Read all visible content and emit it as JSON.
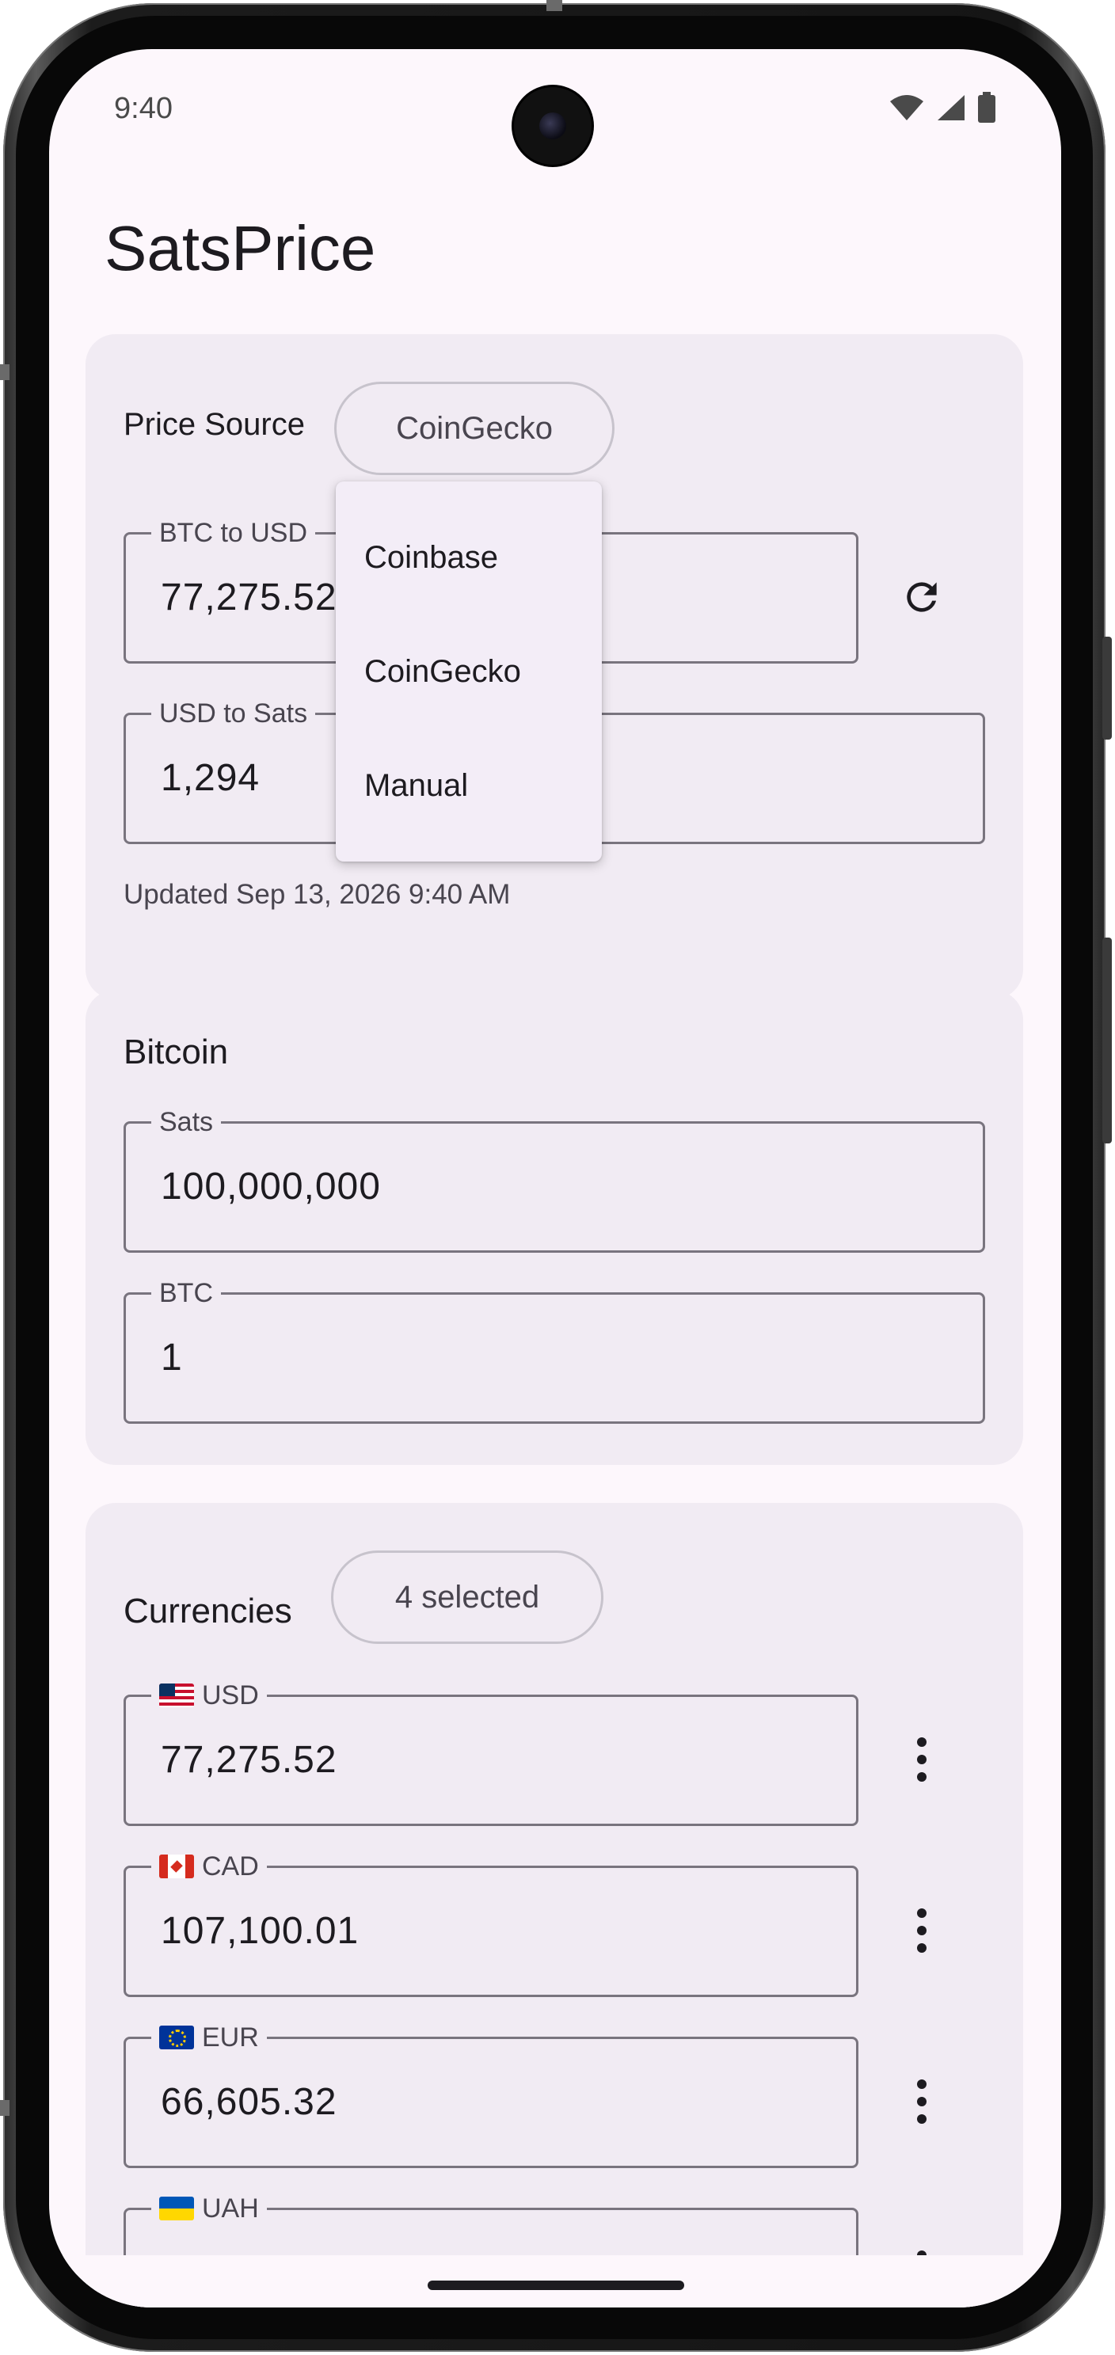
{
  "status_bar": {
    "time": "9:40"
  },
  "app": {
    "title": "SatsPrice"
  },
  "price_source": {
    "label": "Price Source",
    "selected": "CoinGecko",
    "btc_to_usd": {
      "label": "BTC to USD",
      "value": "77,275.52"
    },
    "usd_to_sats": {
      "label": "USD to Sats",
      "value": "1,294"
    },
    "updated": "Updated Sep 13, 2026 9:40 AM",
    "dropdown_options": [
      "Coinbase",
      "CoinGecko",
      "Manual"
    ]
  },
  "bitcoin": {
    "title": "Bitcoin",
    "sats": {
      "label": "Sats",
      "value": "100,000,000"
    },
    "btc": {
      "label": "BTC",
      "value": "1"
    }
  },
  "currencies": {
    "title": "Currencies",
    "selected_chip": "4 selected",
    "items": [
      {
        "code": "USD",
        "flag": "us-flag",
        "value": "77,275.52"
      },
      {
        "code": "CAD",
        "flag": "ca-flag",
        "value": "107,100.01"
      },
      {
        "code": "EUR",
        "flag": "eu-flag",
        "value": "66,605.32"
      },
      {
        "code": "UAH",
        "flag": "ua-flag",
        "value": ""
      }
    ]
  },
  "colors": {
    "background": "#fdf7fc",
    "card": "#f1ebf3",
    "outline": "#79747e",
    "text": "#1d1b20"
  }
}
